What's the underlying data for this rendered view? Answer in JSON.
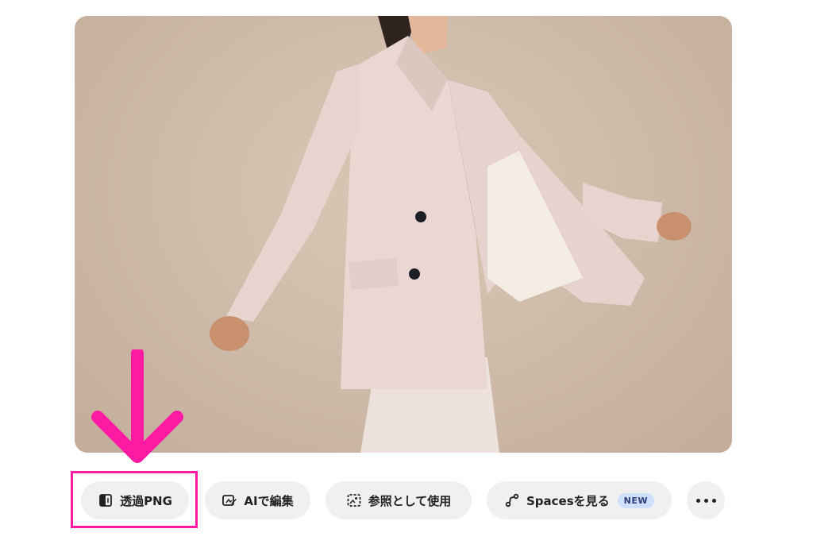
{
  "photo": {
    "subject": "woman-in-blush-blazer"
  },
  "actions": [
    {
      "label": "透過PNG",
      "icon": "transparent-png-icon"
    },
    {
      "label": "AIで編集",
      "icon": "ai-edit-icon"
    },
    {
      "label": "参照として使用",
      "icon": "reference-image-icon"
    },
    {
      "label": "Spacesを見る",
      "icon": "spaces-icon",
      "badge": "NEW"
    }
  ],
  "more_icon": "more-dots-icon",
  "annotation": {
    "color": "#ff1aa3"
  },
  "colors": {
    "pill_bg": "#f0f0f0",
    "badge_bg": "#cfe0ff",
    "badge_text": "#2c3e78"
  }
}
